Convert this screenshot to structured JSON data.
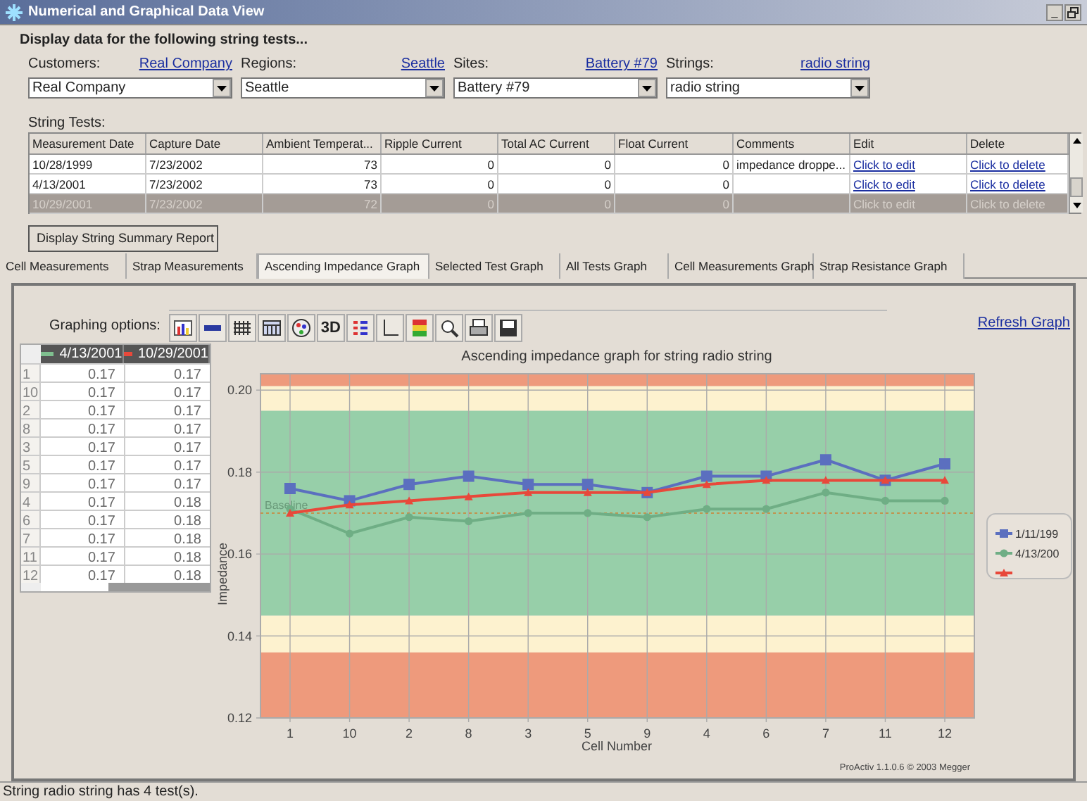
{
  "window": {
    "title": "Numerical and Graphical Data View",
    "controls": [
      "_"
    ]
  },
  "header": "Display data for the following string tests...",
  "filters": [
    {
      "label": "Customers:",
      "link": "Real Company",
      "value": "Real Company"
    },
    {
      "label": "Regions:",
      "link": "Seattle",
      "value": "Seattle"
    },
    {
      "label": "Sites:",
      "link": "Battery #79",
      "value": "Battery #79"
    },
    {
      "label": "Strings:",
      "link": "radio string",
      "value": "radio string"
    }
  ],
  "string_tests": {
    "label": "String Tests:",
    "columns": [
      "Measurement Date",
      "Capture Date",
      "Ambient  Temperat...",
      "Ripple Current",
      "Total AC Current",
      "Float Current",
      "Comments",
      "Edit",
      "Delete"
    ],
    "rows": [
      {
        "selected": false,
        "cells": [
          "10/28/1999",
          "7/23/2002",
          "73",
          "0",
          "0",
          "0",
          "impedance  droppe...",
          "Click to edit",
          "Click to delete"
        ]
      },
      {
        "selected": false,
        "cells": [
          "4/13/2001",
          "7/23/2002",
          "73",
          "0",
          "0",
          "0",
          "",
          "Click to edit",
          "Click to delete"
        ]
      },
      {
        "selected": true,
        "cells": [
          "10/29/2001",
          "7/23/2002",
          "72",
          "0",
          "0",
          "0",
          "",
          "Click to edit",
          "Click to delete"
        ]
      }
    ]
  },
  "summary_button": "Display String Summary Report",
  "tabs": [
    {
      "label": "Cell Measurements",
      "selected": false
    },
    {
      "label": "Strap Measurements",
      "selected": false
    },
    {
      "label": "Ascending Impedance Graph",
      "selected": true
    },
    {
      "label": "Selected Test Graph",
      "selected": false
    },
    {
      "label": "All Tests Graph",
      "selected": false
    },
    {
      "label": "Cell Measurements Graph",
      "selected": false
    },
    {
      "label": "Strap Resistance Graph",
      "selected": false
    }
  ],
  "graphing_options": {
    "label": "Graphing options:",
    "text_button": "3D",
    "refresh": "Refresh Graph"
  },
  "value_table": {
    "columns": [
      {
        "label": "4/13/2001",
        "color": "#7fbf8f"
      },
      {
        "label": "10/29/2001",
        "color": "#e8483a"
      }
    ],
    "rows": [
      {
        "label": "1",
        "values": [
          "0.17",
          "0.17"
        ]
      },
      {
        "label": "10",
        "values": [
          "0.17",
          "0.17"
        ]
      },
      {
        "label": "2",
        "values": [
          "0.17",
          "0.17"
        ]
      },
      {
        "label": "8",
        "values": [
          "0.17",
          "0.17"
        ]
      },
      {
        "label": "3",
        "values": [
          "0.17",
          "0.17"
        ]
      },
      {
        "label": "5",
        "values": [
          "0.17",
          "0.17"
        ]
      },
      {
        "label": "9",
        "values": [
          "0.17",
          "0.17"
        ]
      },
      {
        "label": "4",
        "values": [
          "0.17",
          "0.18"
        ]
      },
      {
        "label": "6",
        "values": [
          "0.17",
          "0.18"
        ]
      },
      {
        "label": "7",
        "values": [
          "0.17",
          "0.18"
        ]
      },
      {
        "label": "11",
        "values": [
          "0.17",
          "0.18"
        ]
      },
      {
        "label": "12",
        "values": [
          "0.17",
          "0.18"
        ]
      }
    ]
  },
  "chart": {
    "chart_data": {
      "type": "line",
      "title": "Ascending impedance graph for string radio string",
      "xlabel": "Cell Number",
      "ylabel": "Impedance",
      "categories": [
        "1",
        "10",
        "2",
        "8",
        "3",
        "5",
        "9",
        "4",
        "6",
        "7",
        "11",
        "12"
      ],
      "grid": true,
      "legend": true,
      "series": [
        {
          "name": "1/11/199",
          "color": "#5b6fbf",
          "marker": "square",
          "values": [
            0.176,
            0.173,
            0.177,
            0.179,
            0.177,
            0.177,
            0.175,
            0.179,
            0.179,
            0.183,
            0.178,
            0.182
          ]
        },
        {
          "name": "4/13/200",
          "color": "#6fae85",
          "marker": "circle",
          "values": [
            0.171,
            0.165,
            0.169,
            0.168,
            0.17,
            0.17,
            0.169,
            0.171,
            0.171,
            0.175,
            0.173,
            0.173
          ]
        },
        {
          "color": "#e8483a",
          "marker": "triangle",
          "values": [
            0.17,
            0.172,
            0.173,
            0.174,
            0.175,
            0.175,
            0.175,
            0.177,
            0.178,
            0.178,
            0.178,
            0.178
          ]
        }
      ],
      "ylim": [
        0.12,
        0.204
      ],
      "yticks": [
        {
          "value": 0.12,
          "label": "0.12"
        },
        {
          "value": 0.14,
          "label": "0.14"
        },
        {
          "value": 0.16,
          "label": "0.16"
        },
        {
          "value": 0.18,
          "label": "0.18"
        },
        {
          "value": 0.2,
          "label": "0.20"
        }
      ],
      "bands": [
        {
          "axis": "y",
          "from": 0.12,
          "to": 0.136,
          "color": "#ee9a7c"
        },
        {
          "axis": "y",
          "from": 0.136,
          "to": 0.145,
          "color": "#fdf2cf"
        },
        {
          "axis": "y",
          "from": 0.145,
          "to": 0.195,
          "color": "#97cfa9"
        },
        {
          "axis": "y",
          "from": 0.195,
          "to": 0.201,
          "color": "#fdf2cf"
        },
        {
          "axis": "y",
          "from": 0.201,
          "to": 0.204,
          "color": "#ee9a7c"
        }
      ],
      "ref_lines": [
        {
          "axis": "y",
          "value": 0.17,
          "label": "Baseline"
        }
      ],
      "annotations": [
        {
          "text": "ProActiv 1.1.0.6 © 2003 Megger"
        }
      ]
    }
  },
  "status_bar": "String radio string has 4 test(s)."
}
